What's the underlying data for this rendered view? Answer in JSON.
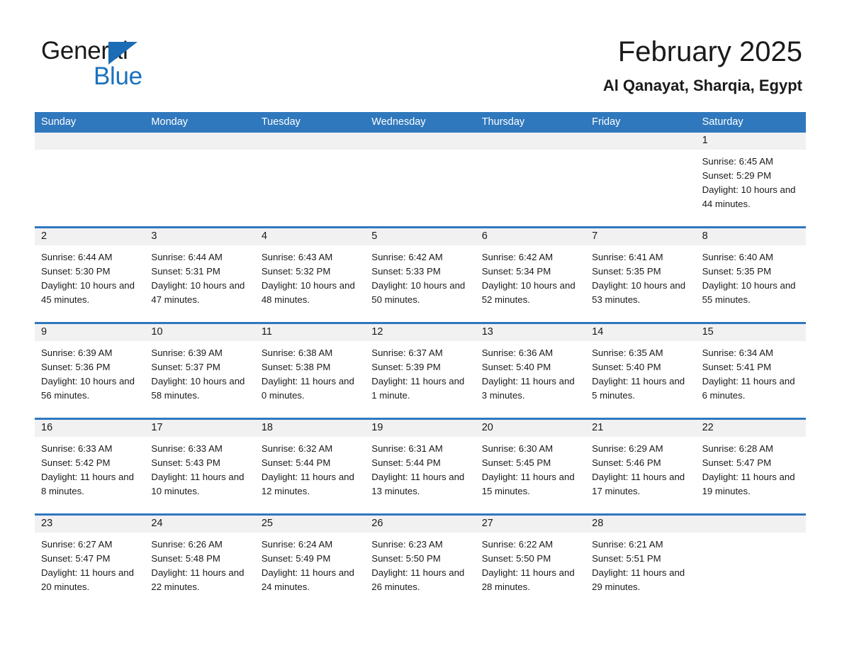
{
  "brand": {
    "name_part1": "General",
    "name_part2": "Blue",
    "triangle_color": "#1b6cb5",
    "blue_color": "#1b72bd"
  },
  "header": {
    "title": "February 2025",
    "location": "Al Qanayat, Sharqia, Egypt"
  },
  "theme": {
    "header_blue": "#2f78bd",
    "daynum_band": "#f1f1f1",
    "text": "#1a1a1a"
  },
  "weekdays": [
    "Sunday",
    "Monday",
    "Tuesday",
    "Wednesday",
    "Thursday",
    "Friday",
    "Saturday"
  ],
  "weeks": [
    [
      {
        "day": "",
        "sunrise": "",
        "sunset": "",
        "daylight": ""
      },
      {
        "day": "",
        "sunrise": "",
        "sunset": "",
        "daylight": ""
      },
      {
        "day": "",
        "sunrise": "",
        "sunset": "",
        "daylight": ""
      },
      {
        "day": "",
        "sunrise": "",
        "sunset": "",
        "daylight": ""
      },
      {
        "day": "",
        "sunrise": "",
        "sunset": "",
        "daylight": ""
      },
      {
        "day": "",
        "sunrise": "",
        "sunset": "",
        "daylight": ""
      },
      {
        "day": "1",
        "sunrise": "Sunrise: 6:45 AM",
        "sunset": "Sunset: 5:29 PM",
        "daylight": "Daylight: 10 hours and 44 minutes."
      }
    ],
    [
      {
        "day": "2",
        "sunrise": "Sunrise: 6:44 AM",
        "sunset": "Sunset: 5:30 PM",
        "daylight": "Daylight: 10 hours and 45 minutes."
      },
      {
        "day": "3",
        "sunrise": "Sunrise: 6:44 AM",
        "sunset": "Sunset: 5:31 PM",
        "daylight": "Daylight: 10 hours and 47 minutes."
      },
      {
        "day": "4",
        "sunrise": "Sunrise: 6:43 AM",
        "sunset": "Sunset: 5:32 PM",
        "daylight": "Daylight: 10 hours and 48 minutes."
      },
      {
        "day": "5",
        "sunrise": "Sunrise: 6:42 AM",
        "sunset": "Sunset: 5:33 PM",
        "daylight": "Daylight: 10 hours and 50 minutes."
      },
      {
        "day": "6",
        "sunrise": "Sunrise: 6:42 AM",
        "sunset": "Sunset: 5:34 PM",
        "daylight": "Daylight: 10 hours and 52 minutes."
      },
      {
        "day": "7",
        "sunrise": "Sunrise: 6:41 AM",
        "sunset": "Sunset: 5:35 PM",
        "daylight": "Daylight: 10 hours and 53 minutes."
      },
      {
        "day": "8",
        "sunrise": "Sunrise: 6:40 AM",
        "sunset": "Sunset: 5:35 PM",
        "daylight": "Daylight: 10 hours and 55 minutes."
      }
    ],
    [
      {
        "day": "9",
        "sunrise": "Sunrise: 6:39 AM",
        "sunset": "Sunset: 5:36 PM",
        "daylight": "Daylight: 10 hours and 56 minutes."
      },
      {
        "day": "10",
        "sunrise": "Sunrise: 6:39 AM",
        "sunset": "Sunset: 5:37 PM",
        "daylight": "Daylight: 10 hours and 58 minutes."
      },
      {
        "day": "11",
        "sunrise": "Sunrise: 6:38 AM",
        "sunset": "Sunset: 5:38 PM",
        "daylight": "Daylight: 11 hours and 0 minutes."
      },
      {
        "day": "12",
        "sunrise": "Sunrise: 6:37 AM",
        "sunset": "Sunset: 5:39 PM",
        "daylight": "Daylight: 11 hours and 1 minute."
      },
      {
        "day": "13",
        "sunrise": "Sunrise: 6:36 AM",
        "sunset": "Sunset: 5:40 PM",
        "daylight": "Daylight: 11 hours and 3 minutes."
      },
      {
        "day": "14",
        "sunrise": "Sunrise: 6:35 AM",
        "sunset": "Sunset: 5:40 PM",
        "daylight": "Daylight: 11 hours and 5 minutes."
      },
      {
        "day": "15",
        "sunrise": "Sunrise: 6:34 AM",
        "sunset": "Sunset: 5:41 PM",
        "daylight": "Daylight: 11 hours and 6 minutes."
      }
    ],
    [
      {
        "day": "16",
        "sunrise": "Sunrise: 6:33 AM",
        "sunset": "Sunset: 5:42 PM",
        "daylight": "Daylight: 11 hours and 8 minutes."
      },
      {
        "day": "17",
        "sunrise": "Sunrise: 6:33 AM",
        "sunset": "Sunset: 5:43 PM",
        "daylight": "Daylight: 11 hours and 10 minutes."
      },
      {
        "day": "18",
        "sunrise": "Sunrise: 6:32 AM",
        "sunset": "Sunset: 5:44 PM",
        "daylight": "Daylight: 11 hours and 12 minutes."
      },
      {
        "day": "19",
        "sunrise": "Sunrise: 6:31 AM",
        "sunset": "Sunset: 5:44 PM",
        "daylight": "Daylight: 11 hours and 13 minutes."
      },
      {
        "day": "20",
        "sunrise": "Sunrise: 6:30 AM",
        "sunset": "Sunset: 5:45 PM",
        "daylight": "Daylight: 11 hours and 15 minutes."
      },
      {
        "day": "21",
        "sunrise": "Sunrise: 6:29 AM",
        "sunset": "Sunset: 5:46 PM",
        "daylight": "Daylight: 11 hours and 17 minutes."
      },
      {
        "day": "22",
        "sunrise": "Sunrise: 6:28 AM",
        "sunset": "Sunset: 5:47 PM",
        "daylight": "Daylight: 11 hours and 19 minutes."
      }
    ],
    [
      {
        "day": "23",
        "sunrise": "Sunrise: 6:27 AM",
        "sunset": "Sunset: 5:47 PM",
        "daylight": "Daylight: 11 hours and 20 minutes."
      },
      {
        "day": "24",
        "sunrise": "Sunrise: 6:26 AM",
        "sunset": "Sunset: 5:48 PM",
        "daylight": "Daylight: 11 hours and 22 minutes."
      },
      {
        "day": "25",
        "sunrise": "Sunrise: 6:24 AM",
        "sunset": "Sunset: 5:49 PM",
        "daylight": "Daylight: 11 hours and 24 minutes."
      },
      {
        "day": "26",
        "sunrise": "Sunrise: 6:23 AM",
        "sunset": "Sunset: 5:50 PM",
        "daylight": "Daylight: 11 hours and 26 minutes."
      },
      {
        "day": "27",
        "sunrise": "Sunrise: 6:22 AM",
        "sunset": "Sunset: 5:50 PM",
        "daylight": "Daylight: 11 hours and 28 minutes."
      },
      {
        "day": "28",
        "sunrise": "Sunrise: 6:21 AM",
        "sunset": "Sunset: 5:51 PM",
        "daylight": "Daylight: 11 hours and 29 minutes."
      },
      {
        "day": "",
        "sunrise": "",
        "sunset": "",
        "daylight": ""
      }
    ]
  ]
}
